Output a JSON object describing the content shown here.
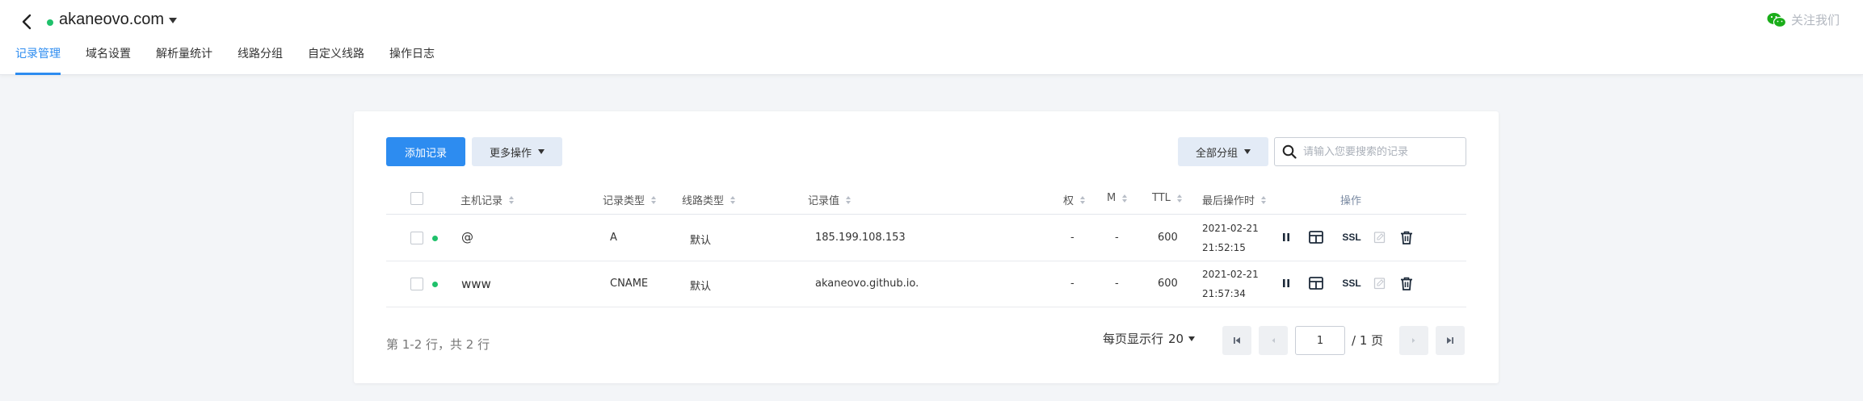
{
  "header": {
    "domain": "akaneovo.com",
    "follow_label": "关注我们"
  },
  "tabs": [
    {
      "label": "记录管理",
      "active": true
    },
    {
      "label": "域名设置",
      "active": false
    },
    {
      "label": "解析量统计",
      "active": false
    },
    {
      "label": "线路分组",
      "active": false
    },
    {
      "label": "自定义线路",
      "active": false
    },
    {
      "label": "操作日志",
      "active": false
    }
  ],
  "toolbar": {
    "add_label": "添加记录",
    "more_label": "更多操作",
    "group_label": "全部分组",
    "search_placeholder": "请输入您要搜索的记录"
  },
  "table": {
    "columns": {
      "host": "主机记录",
      "type": "记录类型",
      "line": "线路类型",
      "value": "记录值",
      "weight": "权",
      "mx": "M",
      "ttl": "TTL",
      "last_op": "最后操作时",
      "actions": "操作"
    },
    "rows": [
      {
        "host": "@",
        "type": "A",
        "line": "默认",
        "value": "185.199.108.153",
        "weight": "-",
        "mx": "-",
        "ttl": "600",
        "date": "2021-02-21",
        "time": "21:52:15",
        "status": "enabled"
      },
      {
        "host": "www",
        "type": "CNAME",
        "line": "默认",
        "value": "akaneovo.github.io.",
        "weight": "-",
        "mx": "-",
        "ttl": "600",
        "date": "2021-02-21",
        "time": "21:57:34",
        "status": "enabled"
      }
    ],
    "action_ssl_label": "SSL"
  },
  "pagination": {
    "summary": "第 1-2 行，共 2 行",
    "page_size_label": "每页显示行",
    "page_size": "20",
    "current_page": "1",
    "total_pages": "/ 1 页"
  },
  "colors": {
    "accent": "#2d8cf0",
    "status_enabled": "#1fc16b"
  }
}
